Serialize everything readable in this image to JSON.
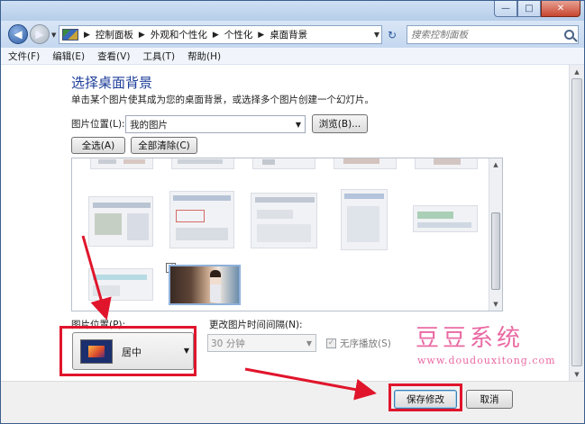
{
  "window": {
    "minimize_glyph": "—",
    "maximize_glyph": "□",
    "close_glyph": "✕"
  },
  "navigation": {
    "back_glyph": "◀",
    "forward_glyph": "▶",
    "breadcrumbs": [
      "控制面板",
      "外观和个性化",
      "个性化",
      "桌面背景"
    ],
    "separator": "▶",
    "refresh_glyph": "↻",
    "search_placeholder": "搜索控制面板"
  },
  "menu": {
    "items": [
      "文件(F)",
      "编辑(E)",
      "查看(V)",
      "工具(T)",
      "帮助(H)"
    ]
  },
  "page": {
    "title": "选择桌面背景",
    "subtitle": "单击某个图片使其成为您的桌面背景，或选择多个图片创建一个幻灯片。",
    "picture_location_label": "图片位置(L):",
    "picture_location_value": "我的图片",
    "browse_button": "浏览(B)...",
    "select_all_button": "全选(A)",
    "clear_all_button": "全部清除(C)",
    "selected_check": "✓",
    "position_label": "图片位置(P):",
    "position_value": "居中",
    "interval_label": "更改图片时间间隔(N):",
    "interval_value": "30 分钟",
    "shuffle_label": "无序播放(S)",
    "shuffle_checked": true
  },
  "watermark": {
    "title": "豆豆系统",
    "url": "www.doudouxitong.com"
  },
  "footer": {
    "save_button": "保存修改",
    "cancel_button": "取消"
  },
  "colors": {
    "title_blue": "#1e3f9a",
    "highlight_red": "#e0152c",
    "watermark_pink": "#ea6aa3"
  }
}
